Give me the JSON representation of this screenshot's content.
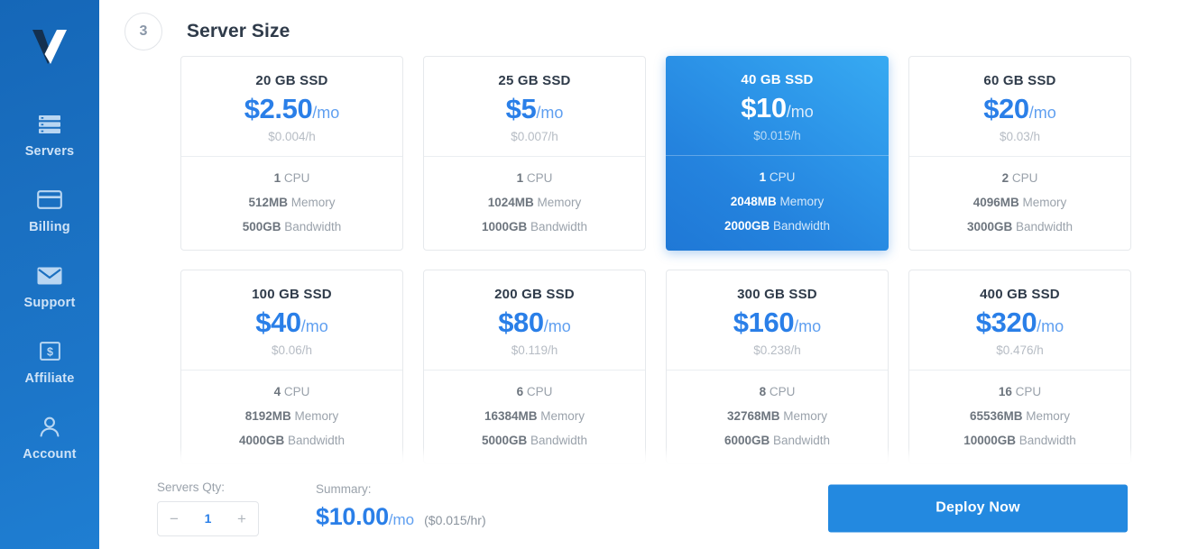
{
  "sidebar": {
    "logo_name": "vultr-logo",
    "items": [
      {
        "label": "Servers",
        "icon": "servers-icon"
      },
      {
        "label": "Billing",
        "icon": "credit-card-icon"
      },
      {
        "label": "Support",
        "icon": "envelope-icon"
      },
      {
        "label": "Affiliate",
        "icon": "dollar-box-icon"
      },
      {
        "label": "Account",
        "icon": "person-icon"
      }
    ]
  },
  "header": {
    "step_number": "3",
    "title": "Server Size"
  },
  "plans": [
    {
      "name": "20 GB SSD",
      "price": "$2.50",
      "per": "/mo",
      "hourly": "$0.004/h",
      "cpu": "1",
      "cpu_label": "CPU",
      "memory": "512MB",
      "memory_label": "Memory",
      "bandwidth": "500GB",
      "bandwidth_label": "Bandwidth",
      "selected": false
    },
    {
      "name": "25 GB SSD",
      "price": "$5",
      "per": "/mo",
      "hourly": "$0.007/h",
      "cpu": "1",
      "cpu_label": "CPU",
      "memory": "1024MB",
      "memory_label": "Memory",
      "bandwidth": "1000GB",
      "bandwidth_label": "Bandwidth",
      "selected": false
    },
    {
      "name": "40 GB SSD",
      "price": "$10",
      "per": "/mo",
      "hourly": "$0.015/h",
      "cpu": "1",
      "cpu_label": "CPU",
      "memory": "2048MB",
      "memory_label": "Memory",
      "bandwidth": "2000GB",
      "bandwidth_label": "Bandwidth",
      "selected": true
    },
    {
      "name": "60 GB SSD",
      "price": "$20",
      "per": "/mo",
      "hourly": "$0.03/h",
      "cpu": "2",
      "cpu_label": "CPU",
      "memory": "4096MB",
      "memory_label": "Memory",
      "bandwidth": "3000GB",
      "bandwidth_label": "Bandwidth",
      "selected": false
    },
    {
      "name": "100 GB SSD",
      "price": "$40",
      "per": "/mo",
      "hourly": "$0.06/h",
      "cpu": "4",
      "cpu_label": "CPU",
      "memory": "8192MB",
      "memory_label": "Memory",
      "bandwidth": "4000GB",
      "bandwidth_label": "Bandwidth",
      "selected": false
    },
    {
      "name": "200 GB SSD",
      "price": "$80",
      "per": "/mo",
      "hourly": "$0.119/h",
      "cpu": "6",
      "cpu_label": "CPU",
      "memory": "16384MB",
      "memory_label": "Memory",
      "bandwidth": "5000GB",
      "bandwidth_label": "Bandwidth",
      "selected": false
    },
    {
      "name": "300 GB SSD",
      "price": "$160",
      "per": "/mo",
      "hourly": "$0.238/h",
      "cpu": "8",
      "cpu_label": "CPU",
      "memory": "32768MB",
      "memory_label": "Memory",
      "bandwidth": "6000GB",
      "bandwidth_label": "Bandwidth",
      "selected": false
    },
    {
      "name": "400 GB SSD",
      "price": "$320",
      "per": "/mo",
      "hourly": "$0.476/h",
      "cpu": "16",
      "cpu_label": "CPU",
      "memory": "65536MB",
      "memory_label": "Memory",
      "bandwidth": "10000GB",
      "bandwidth_label": "Bandwidth",
      "selected": false
    }
  ],
  "footer": {
    "qty_label": "Servers Qty:",
    "qty_value": "1",
    "decrement": "−",
    "increment": "+",
    "summary_label": "Summary:",
    "summary_price": "$10.00",
    "summary_per": "/mo",
    "summary_hourly": "($0.015/hr)",
    "deploy_label": "Deploy Now"
  },
  "colors": {
    "accent_blue": "#2a7fe8",
    "accent_blue_light": "#5f9ff0",
    "sidebar_blue": "#1a6fc0",
    "selected_card_blue": "#2c94e8",
    "deploy_button_blue": "#2389e0"
  }
}
